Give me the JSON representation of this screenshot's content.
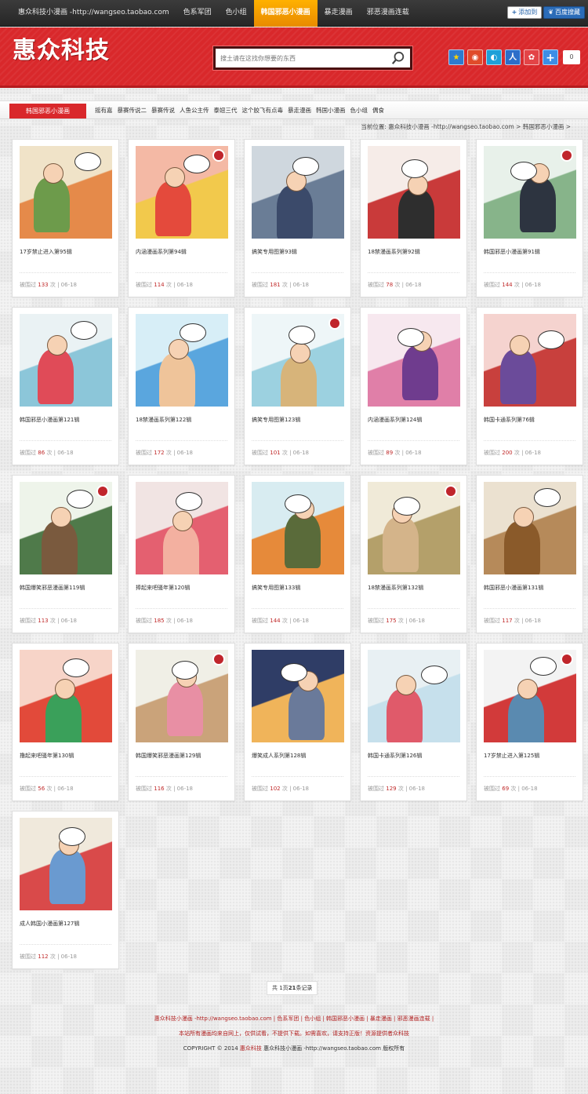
{
  "topnav": {
    "items": [
      {
        "label": "惠众科技小漫画 -http://wangseo.taobao.com",
        "active": false
      },
      {
        "label": "色系军团",
        "active": false
      },
      {
        "label": "色小组",
        "active": false
      },
      {
        "label": "韩国邪恶小漫画",
        "active": true
      },
      {
        "label": "暴走漫画",
        "active": false
      },
      {
        "label": "邪恶漫画连载",
        "active": false
      }
    ],
    "add_fav": "添加到",
    "baidu_collect": "百度搜藏"
  },
  "header": {
    "logo": "惠众科技",
    "search_placeholder": "搜土请在这找你想要的东西",
    "share_count": "0"
  },
  "catbar": {
    "title": "韩国邪恶小漫画",
    "links": [
      "摇有嘉",
      "暴赛传说二",
      "暴赛传说",
      "人鱼公主传",
      "泰妞三代",
      "这个胶飞有点毒",
      "暴走漫画",
      "韩国小漫画",
      "色小组",
      "偶食"
    ]
  },
  "breadcrumb": "当前位置: 惠众科技小漫画 -http://wangseo.taobao.com > 韩国邪恶小漫画 >",
  "cards": [
    {
      "title": "17岁禁止进入第95辑",
      "views": "133",
      "date": "06-18"
    },
    {
      "title": "内涵漫画系列第94辑",
      "views": "114",
      "date": "06-18"
    },
    {
      "title": "搞笑专用图第93辑",
      "views": "181",
      "date": "06-18"
    },
    {
      "title": "18禁漫画系列第92辑",
      "views": "78",
      "date": "06-18"
    },
    {
      "title": "韩国邪恶小漫画第91辑",
      "views": "144",
      "date": "06-18"
    },
    {
      "title": "韩国邪恶小漫画第121辑",
      "views": "86",
      "date": "06-18"
    },
    {
      "title": "18禁漫画系列第122辑",
      "views": "172",
      "date": "06-18"
    },
    {
      "title": "搞笑专用图第123辑",
      "views": "101",
      "date": "06-18"
    },
    {
      "title": "内涵漫画系列第124辑",
      "views": "89",
      "date": "06-18"
    },
    {
      "title": "韩国卡通系列第76辑",
      "views": "200",
      "date": "06-18"
    },
    {
      "title": "韩国爆笑邪恶漫画第119辑",
      "views": "113",
      "date": "06-18"
    },
    {
      "title": "捧起来吧骚年第120辑",
      "views": "185",
      "date": "06-18"
    },
    {
      "title": "搞笑专用图第133辑",
      "views": "144",
      "date": "06-18"
    },
    {
      "title": "18禁漫画系列第132辑",
      "views": "175",
      "date": "06-18"
    },
    {
      "title": "韩国邪恶小漫画第131辑",
      "views": "117",
      "date": "06-18"
    },
    {
      "title": "撸起来吧骚年第130辑",
      "views": "56",
      "date": "06-18"
    },
    {
      "title": "韩国爆笑邪恶漫画第129辑",
      "views": "116",
      "date": "06-18"
    },
    {
      "title": "爆笑成人系列第128辑",
      "views": "102",
      "date": "06-18"
    },
    {
      "title": "韩国卡通系列第126辑",
      "views": "129",
      "date": "06-18"
    },
    {
      "title": "17岁禁止进入第125辑",
      "views": "69",
      "date": "06-18"
    },
    {
      "title": "成人韩国小漫画第127辑",
      "views": "112",
      "date": "06-18"
    }
  ],
  "views_prefix": "被围过",
  "views_suffix": "次",
  "pager": {
    "prefix": "共 1页",
    "count": "21",
    "suffix": "条记录"
  },
  "footer": {
    "links": [
      "惠众科技小漫画 -http://wangseo.taobao.com",
      "色系军团",
      "色小组",
      "韩国邪恶小漫画",
      "暴走漫画",
      "邪恶漫画连载"
    ],
    "notice": "本站所有漫画均来自网上，仅供试看，不提供下载。如需喜欢，请支持正版！资源提供者众科技",
    "copy_prefix": "COPYRIGHT © 2014",
    "copy_brand": "惠众科技",
    "copy_suffix": "惠众科技小漫画 -http://wangseo.taobao.com 版权所有"
  },
  "thumb_colors": [
    [
      "#f0e3c8",
      "#e58a4a",
      "#6d9b4b"
    ],
    [
      "#f4b9a5",
      "#f2c94c",
      "#e44a3c"
    ],
    [
      "#cfd7de",
      "#6a7d96",
      "#3b4a6a"
    ],
    [
      "#f6ece8",
      "#c93a3a",
      "#2e2e2e"
    ],
    [
      "#e8f1ea",
      "#87b48a",
      "#2d3440"
    ],
    [
      "#eaf2f4",
      "#8cc6d9",
      "#e04b58"
    ],
    [
      "#d7eef7",
      "#5aa6de",
      "#efc49a"
    ],
    [
      "#eef6f8",
      "#9cd1e0",
      "#d7b47a"
    ],
    [
      "#f7e8ef",
      "#e07fa8",
      "#6f3c8e"
    ],
    [
      "#f5d3cf",
      "#c8403d",
      "#6b4b9a"
    ],
    [
      "#eef4ea",
      "#4f7a4a",
      "#7a5a3e"
    ],
    [
      "#f1e4e3",
      "#e46070",
      "#f3b0a0"
    ],
    [
      "#d8ecf1",
      "#e68a3a",
      "#5a6b3a"
    ],
    [
      "#f0ead8",
      "#b4a06a",
      "#d4b48a"
    ],
    [
      "#ebe1d0",
      "#b68a5a",
      "#8a5a2a"
    ],
    [
      "#f7d4c8",
      "#e24a3a",
      "#3aa05a"
    ],
    [
      "#f0efe6",
      "#caa37a",
      "#e88fa4"
    ],
    [
      "#2f3d66",
      "#f0b45a",
      "#6a7a9a"
    ],
    [
      "#e8f0f3",
      "#c6e0ec",
      "#e05a6a"
    ],
    [
      "#f3f3f3",
      "#d23a3a",
      "#5a8ab0"
    ],
    [
      "#f0e9dc",
      "#d94a4a",
      "#6a9ad0"
    ]
  ]
}
